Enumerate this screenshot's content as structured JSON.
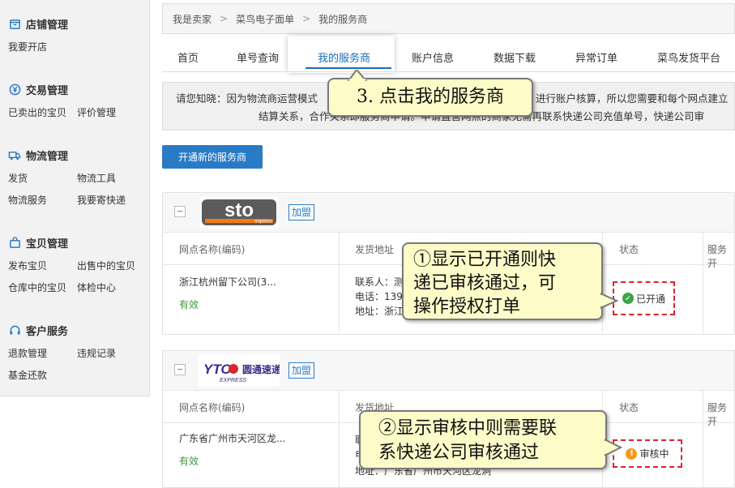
{
  "sidebar": {
    "sections": [
      {
        "title": "店铺管理",
        "icon": "store-icon",
        "links": [
          "我要开店"
        ]
      },
      {
        "title": "交易管理",
        "icon": "yen-icon",
        "links": [
          "已卖出的宝贝",
          "评价管理"
        ]
      },
      {
        "title": "物流管理",
        "icon": "truck-icon",
        "links": [
          "发货",
          "物流工具",
          "物流服务",
          "我要寄快递"
        ]
      },
      {
        "title": "宝贝管理",
        "icon": "bag-icon",
        "links": [
          "发布宝贝",
          "出售中的宝贝",
          "仓库中的宝贝",
          "体检中心"
        ]
      },
      {
        "title": "客户服务",
        "icon": "headset-icon",
        "links": [
          "退款管理",
          "违规记录",
          "基金还款"
        ]
      }
    ]
  },
  "breadcrumb": [
    "我是卖家",
    "菜鸟电子面单",
    "我的服务商"
  ],
  "tabs": [
    "首页",
    "单号查询",
    "我的服务商",
    "账户信息",
    "数据下载",
    "异常订单",
    "菜鸟发货平台"
  ],
  "active_tab": "我的服务商",
  "notice": {
    "line1": "请您知晓：因为物流商运营模式",
    "line1_tail": "进行账户核算，所以您需要和每个网点建立",
    "line2": "结算关系，合作关系即服务商申请。申请直营网点的商家无需再联系快递公司充值单号，快递公司审",
    "line2_short": "结算关系，合作关系即服务商申请。"
  },
  "open_button": "开通新的服务商",
  "columns": [
    "网点名称(编码)",
    "发货地址",
    "状态",
    "服务开"
  ],
  "providers": [
    {
      "logo": "sto",
      "logo_sub": "express",
      "join_label": "加盟",
      "site_name": "浙江杭州留下公司(3...",
      "validity": "有效",
      "contact": "联系人：测",
      "phone": "电话：139",
      "address": "地址：浙江",
      "status": "已开通",
      "status_color": "#3aa54a"
    },
    {
      "logo": "YTO",
      "logo_cn": "圆通速递",
      "logo_sub": "EXPRESS",
      "join_label": "加盟",
      "site_name": "广东省广州市天河区龙...",
      "validity": "有效",
      "contact": "联",
      "phone": "电",
      "address": "地址：广东省广州市天河区龙洞",
      "status": "审核中",
      "status_color": "#f29b1d"
    }
  ],
  "callouts": {
    "step3": "3. 点击我的服务商",
    "note1": [
      "①显示已开通则快",
      "递已审核通过，可",
      "操作授权打单"
    ],
    "note2": [
      "②显示审核中则需要联",
      "系快递公司审核通过"
    ]
  }
}
